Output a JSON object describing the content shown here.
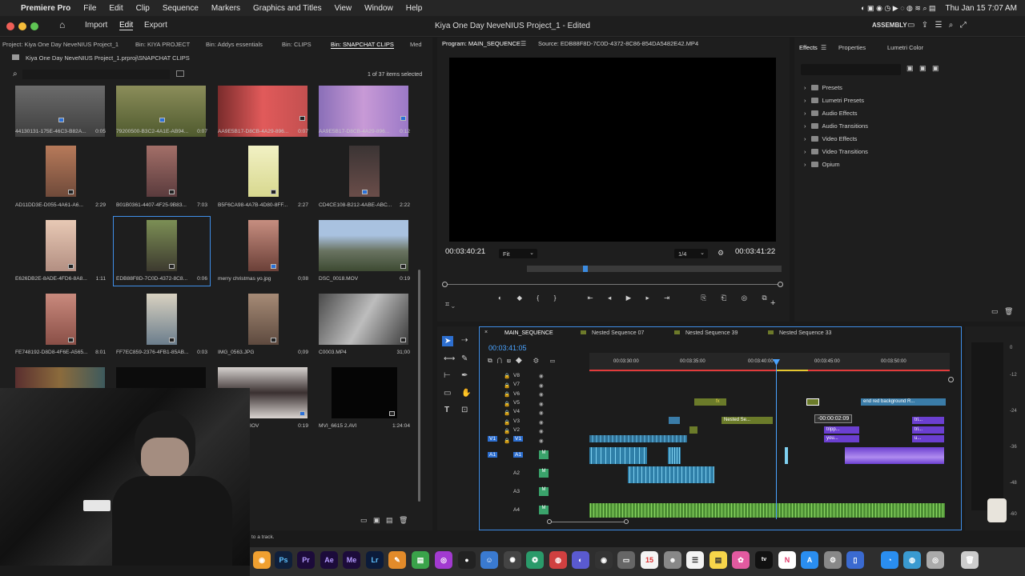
{
  "menubar": {
    "app_name": "Premiere Pro",
    "items": [
      "File",
      "Edit",
      "Clip",
      "Sequence",
      "Markers",
      "Graphics and Titles",
      "View",
      "Window",
      "Help"
    ],
    "clock": "Thu Jan 15  7:07 AM"
  },
  "titlebar": {
    "nav_import": "Import",
    "nav_edit": "Edit",
    "nav_export": "Export",
    "title": "Kiya One Day NeveNIUS Project_1 - Edited",
    "workspace": "ASSEMBLY"
  },
  "project": {
    "tabs": [
      "Project: Kiya One Day NeveNIUS Project_1",
      "Bin: KIYA PROJECT",
      "Bin: Addys essentials",
      "Bin: CLIPS",
      "Bin: SNAPCHAT CLIPS",
      "Med"
    ],
    "path": "Kiya One Day NeveNIUS Project_1.prproj\\SNAPCHAT CLIPS",
    "selected_count": "1 of 37 items selected",
    "items": [
      {
        "name": "44130131-175E-46C3-B82A...",
        "dur": "0:05"
      },
      {
        "name": "79200500-B3C2-4A1E-AB94...",
        "dur": "0:07"
      },
      {
        "name": "AA9E5B17-D8CB-4A29-896...",
        "dur": "0:07"
      },
      {
        "name": "AA9E5B17-D8CB-4A29-896...",
        "dur": "0:12"
      },
      {
        "name": "AD11DD3E-D055-4A61-A6...",
        "dur": "2:29"
      },
      {
        "name": "B01B0361-4407-4F25-9B83...",
        "dur": "7:03"
      },
      {
        "name": "B5F6CA98-4A7B-4D80-8FF...",
        "dur": "2:27"
      },
      {
        "name": "CD4CE108-B212-4ABE-ABC...",
        "dur": "2:22"
      },
      {
        "name": "E626DB2E-8ADE-4FD6-8A8...",
        "dur": "1:11"
      },
      {
        "name": "EDB88F8D-7C0D-4372-8C8...",
        "dur": "0:06"
      },
      {
        "name": "merry christmas yo.jpg",
        "dur": "0;08"
      },
      {
        "name": "DSC_0018.MOV",
        "dur": "0:19"
      },
      {
        "name": "FE748192-D8D8-4F6E-A565...",
        "dur": "8:01"
      },
      {
        "name": "FF7EC859-2376-4FB1-85AB...",
        "dur": "0:03"
      },
      {
        "name": "IMG_0563.JPG",
        "dur": "0;09"
      },
      {
        "name": "C0003.MP4",
        "dur": "31;00"
      },
      {
        "name": "",
        "dur": ""
      },
      {
        "name": "",
        "dur": ""
      },
      {
        "name": "IOV",
        "dur": "0:19"
      },
      {
        "name": "MVI_6615 2.AVI",
        "dur": "1:24:04"
      }
    ],
    "status_hint": "to a track."
  },
  "monitor": {
    "program_tab": "Program: MAIN_SEQUENCE",
    "source_tab": "Source: EDB88F8D-7C0D-4372-8C86-854DA5482E42.MP4",
    "timecode_left": "00:03:40:21",
    "fit": "Fit",
    "resolution": "1/4",
    "timecode_right": "00:03:41:22",
    "playhead_fraction": 0.22
  },
  "effects": {
    "tabs": [
      "Effects",
      "Properties",
      "Lumetri Color"
    ],
    "folders": [
      "Presets",
      "Lumetri Presets",
      "Audio Effects",
      "Audio Transitions",
      "Video Effects",
      "Video Transitions",
      "Opium"
    ]
  },
  "timeline": {
    "tabs": [
      "MAIN_SEQUENCE",
      "Nested Sequence 07",
      "Nested Sequence 39",
      "Nested Sequence 33"
    ],
    "timecode": "00:03:41:05",
    "ruler": [
      "00:03:30:00",
      "00:03:35:00",
      "00:03:40:00",
      "00:03:45:00",
      "00:03:50:00"
    ],
    "video_tracks": [
      "V8",
      "V7",
      "V6",
      "V5",
      "V4",
      "V3",
      "V2",
      "V1"
    ],
    "audio_tracks": [
      "A1",
      "A2",
      "A3",
      "A4"
    ],
    "clip_labels": {
      "fx": "fx",
      "nested": "Nested Se...",
      "end_red": "end red background R...",
      "tripp": "tripp...",
      "you": "you...",
      "tri": "tri...",
      "u": "u..."
    },
    "tooltip": "-00:00:02:09"
  },
  "meter": {
    "scale": [
      "0",
      "-12",
      "-24",
      "-36",
      "-48",
      "-60"
    ]
  },
  "colors": {
    "accent_blue": "#2d8ceb",
    "video_clip_green": "#6b7b2a",
    "audio_clip_blue": "#3a8fb5",
    "audio_clip_green": "#5aa83d",
    "clip_purple": "#6b3fd0",
    "playhead_red": "#e23b3b"
  }
}
